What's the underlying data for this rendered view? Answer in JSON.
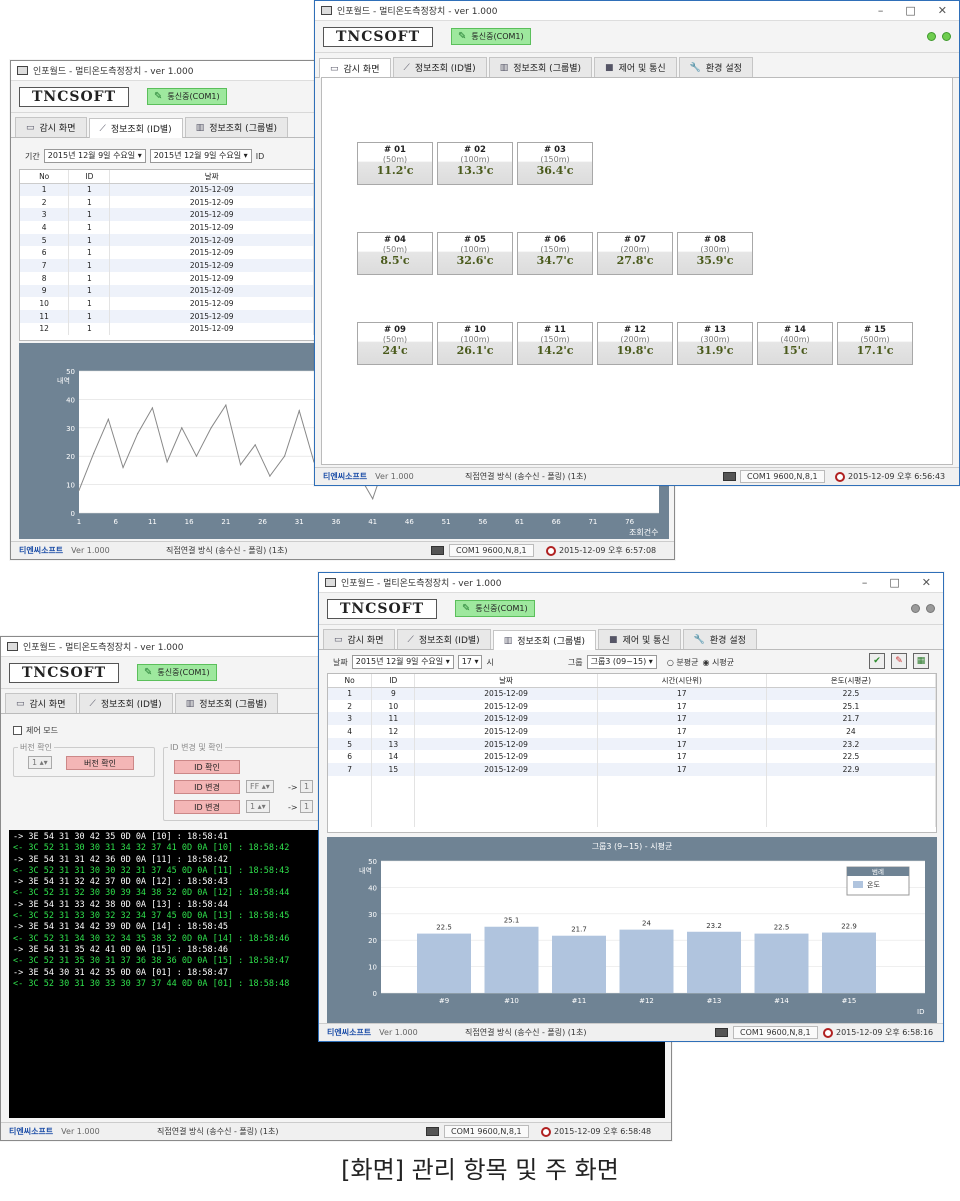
{
  "app": {
    "title": "인포월드 - 멀티온도측정장치 - ver 1.000",
    "logo": "TNCSOFT",
    "comm": "통신중(COM1)"
  },
  "tabs": {
    "monitor": "감시 화면",
    "by_id": "정보조회 (ID별)",
    "by_group": "정보조회 (그룹별)",
    "control": "제어 및 통신",
    "settings": "환경 설정"
  },
  "status": {
    "company": "티엔씨소프트",
    "version": "Ver 1.000",
    "mode": "직접연결 방식 (송수신 - 폴링) (1초)",
    "port": "COM1 9600,N,8,1",
    "time_w1": "2015-12-09 오후 6:57:08",
    "time_w2": "2015-12-09 오후 6:56:43",
    "time_w3": "2015-12-09 오후 6:58:48",
    "time_w4": "2015-12-09 오후 6:58:16"
  },
  "window_controls": {
    "minimize": "–",
    "maximize": "□",
    "close": "✕"
  },
  "sensors": [
    {
      "id": "# 01",
      "dist": "(50m)",
      "temp": "11.2'c"
    },
    {
      "id": "# 02",
      "dist": "(100m)",
      "temp": "13.3'c"
    },
    {
      "id": "# 03",
      "dist": "(150m)",
      "temp": "36.4'c"
    },
    {
      "id": "# 04",
      "dist": "(50m)",
      "temp": "8.5'c"
    },
    {
      "id": "# 05",
      "dist": "(100m)",
      "temp": "32.6'c"
    },
    {
      "id": "# 06",
      "dist": "(150m)",
      "temp": "34.7'c"
    },
    {
      "id": "# 07",
      "dist": "(200m)",
      "temp": "27.8'c"
    },
    {
      "id": "# 08",
      "dist": "(300m)",
      "temp": "35.9'c"
    },
    {
      "id": "# 09",
      "dist": "(50m)",
      "temp": "24'c"
    },
    {
      "id": "# 10",
      "dist": "(100m)",
      "temp": "26.1'c"
    },
    {
      "id": "# 11",
      "dist": "(150m)",
      "temp": "14.2'c"
    },
    {
      "id": "# 12",
      "dist": "(200m)",
      "temp": "19.8'c"
    },
    {
      "id": "# 13",
      "dist": "(300m)",
      "temp": "31.9'c"
    },
    {
      "id": "# 14",
      "dist": "(400m)",
      "temp": "15'c"
    },
    {
      "id": "# 15",
      "dist": "(500m)",
      "temp": "17.1'c"
    }
  ],
  "id_query": {
    "period_label": "기간",
    "date_from": "2015년 12월  9일 수요일",
    "date_to": "2015년 12월  9일 수요일",
    "id_label": "ID",
    "columns": [
      "No",
      "ID",
      "날짜"
    ],
    "rows": [
      [
        "1",
        "1",
        "2015-12-09"
      ],
      [
        "2",
        "1",
        "2015-12-09"
      ],
      [
        "3",
        "1",
        "2015-12-09"
      ],
      [
        "4",
        "1",
        "2015-12-09"
      ],
      [
        "5",
        "1",
        "2015-12-09"
      ],
      [
        "6",
        "1",
        "2015-12-09"
      ],
      [
        "7",
        "1",
        "2015-12-09"
      ],
      [
        "8",
        "1",
        "2015-12-09"
      ],
      [
        "9",
        "1",
        "2015-12-09"
      ],
      [
        "10",
        "1",
        "2015-12-09"
      ],
      [
        "11",
        "1",
        "2015-12-09"
      ],
      [
        "12",
        "1",
        "2015-12-09"
      ]
    ]
  },
  "control": {
    "control_mode": "제어 모드",
    "version_group": "버전 확인",
    "version_spin": "1",
    "version_btn": "버전 확인",
    "id_group": "ID 변경 및 확인",
    "id_check": "ID 확인",
    "id_change1": "ID 변경",
    "id_change2": "ID 변경",
    "ff": "FF",
    "one": "1",
    "arrow": "->",
    "log": [
      {
        "c": "w",
        "t": "-> 3E 54 31 30 42 35 0D 0A  [10]   :  18:58:41"
      },
      {
        "c": "g",
        "t": "<- 3C 52 31 30 30 31 34 32 37 41 0D 0A  [10]   :  18:58:42"
      },
      {
        "c": "w",
        "t": "-> 3E 54 31 31 42 36 0D 0A  [11]   :  18:58:42"
      },
      {
        "c": "g",
        "t": "<- 3C 52 31 31 30 30 32 31 37 45 0D 0A  [11]   :  18:58:43"
      },
      {
        "c": "w",
        "t": "-> 3E 54 31 32 42 37 0D 0A  [12]   :  18:58:43"
      },
      {
        "c": "g",
        "t": "<- 3C 52 31 32 30 30 39 34 38 32 0D 0A  [12]   :  18:58:44"
      },
      {
        "c": "w",
        "t": "-> 3E 54 31 33 42 38 0D 0A  [13]   :  18:58:44"
      },
      {
        "c": "g",
        "t": "<- 3C 52 31 33 30 32 32 34 37 45 0D 0A  [13]   :  18:58:45"
      },
      {
        "c": "w",
        "t": "-> 3E 54 31 34 42 39 0D 0A  [14]   :  18:58:45"
      },
      {
        "c": "g",
        "t": "<- 3C 52 31 34 30 32 34 35 38 32 0D 0A  [14]   :  18:58:46"
      },
      {
        "c": "w",
        "t": "-> 3E 54 31 35 42 41 0D 0A  [15]   :  18:58:46"
      },
      {
        "c": "g",
        "t": "<- 3C 52 31 35 30 31 37 36 38 36 0D 0A  [15]   :  18:58:47"
      },
      {
        "c": "w",
        "t": "-> 3E 54 30 31 42 35 0D 0A  [01]   :  18:58:47"
      },
      {
        "c": "g",
        "t": "<- 3C 52 30 31 30 33 30 37 37 44 0D 0A  [01]   :  18:58:48"
      }
    ]
  },
  "group_query": {
    "date_label": "날짜",
    "date": "2015년 12월  9일 수요일",
    "hour": "17",
    "hour_unit": "시",
    "group_label": "그룹",
    "group": "그룹3 (09~15)",
    "radio_min": "분평균",
    "radio_hour": "시평균",
    "columns": [
      "No",
      "ID",
      "날짜",
      "시간(시단위)",
      "온도(시평균)"
    ],
    "rows": [
      [
        "1",
        "9",
        "2015-12-09",
        "17",
        "22.5"
      ],
      [
        "2",
        "10",
        "2015-12-09",
        "17",
        "25.1"
      ],
      [
        "3",
        "11",
        "2015-12-09",
        "17",
        "21.7"
      ],
      [
        "4",
        "12",
        "2015-12-09",
        "17",
        "24"
      ],
      [
        "5",
        "13",
        "2015-12-09",
        "17",
        "23.2"
      ],
      [
        "6",
        "14",
        "2015-12-09",
        "17",
        "22.5"
      ],
      [
        "7",
        "15",
        "2015-12-09",
        "17",
        "22.9"
      ]
    ]
  },
  "chart_data": [
    {
      "type": "line",
      "ylabel": "내역",
      "xlabel": "조회건수",
      "ylim": [
        0,
        50
      ],
      "yticks": [
        0,
        10,
        20,
        30,
        40,
        50
      ],
      "xticks": [
        1,
        6,
        11,
        16,
        21,
        26,
        31,
        36,
        41,
        46,
        51,
        56,
        61,
        66,
        71,
        76
      ],
      "x": [
        1,
        3,
        5,
        7,
        9,
        11,
        13,
        15,
        17,
        19,
        21,
        23,
        25,
        27,
        29,
        31,
        33,
        35,
        37,
        39,
        41,
        43,
        45,
        47,
        49,
        51,
        53,
        55,
        57,
        59,
        61,
        63,
        65,
        67,
        69,
        71,
        73,
        75,
        77,
        79,
        81,
        83,
        85,
        87
      ],
      "values": [
        8,
        21,
        33,
        16,
        28,
        37,
        18,
        30,
        20,
        30,
        38,
        17,
        24,
        13,
        20,
        36,
        18,
        20,
        24,
        14,
        5,
        20,
        26,
        11,
        22,
        33,
        35,
        17,
        26,
        16,
        29,
        25,
        13,
        24,
        33,
        21,
        20,
        27,
        34,
        15,
        25,
        22,
        14,
        30
      ]
    },
    {
      "type": "bar",
      "title": "그룹3  (9~15) - 시평균",
      "ylabel": "내역",
      "xlabel": "ID",
      "ylim": [
        0,
        50
      ],
      "yticks": [
        0,
        10,
        20,
        30,
        40,
        50
      ],
      "categories": [
        "#9",
        "#10",
        "#11",
        "#12",
        "#13",
        "#14",
        "#15"
      ],
      "series": [
        {
          "name": "온도",
          "values": [
            22.5,
            25.1,
            21.7,
            24,
            23.2,
            22.5,
            22.9
          ]
        }
      ],
      "legend_title": "범례",
      "color": "#b0c4de"
    }
  ],
  "caption": "[화면] 관리 항목 및 주 화면"
}
